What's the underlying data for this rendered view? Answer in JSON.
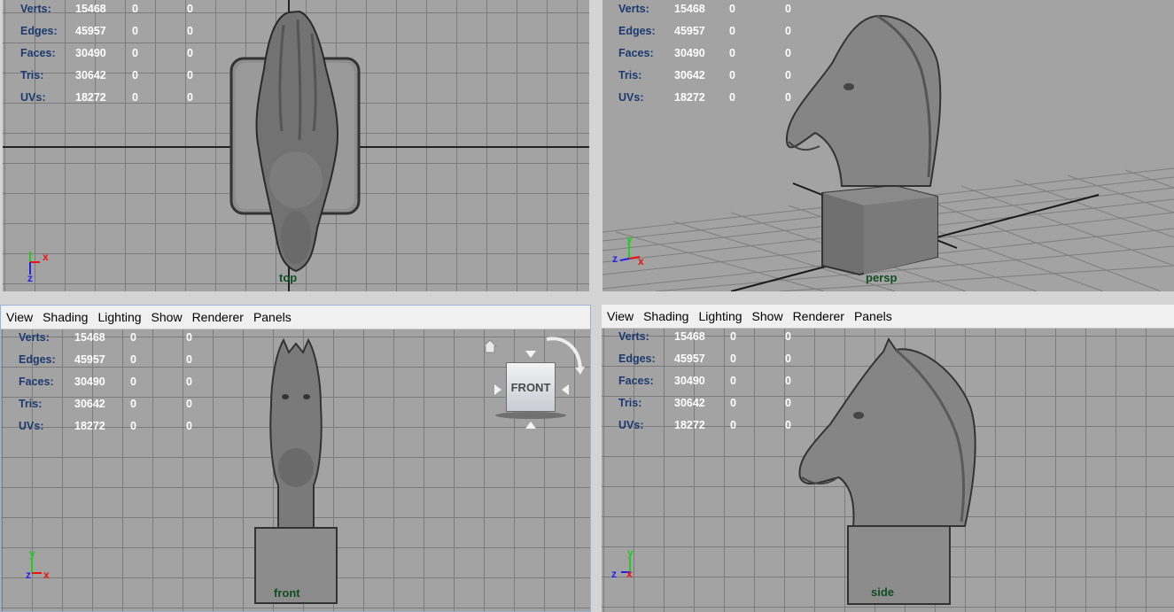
{
  "menu": [
    "View",
    "Shading",
    "Lighting",
    "Show",
    "Renderer",
    "Panels"
  ],
  "hud": {
    "labels": [
      "Verts:",
      "Edges:",
      "Faces:",
      "Tris:",
      "UVs:"
    ],
    "values": [
      "15468",
      "45957",
      "30490",
      "30642",
      "18272"
    ],
    "zeros": [
      "0",
      "0"
    ]
  },
  "viewports": {
    "top": {
      "camera": "top"
    },
    "persp": {
      "camera": "persp"
    },
    "front": {
      "camera": "front"
    },
    "side": {
      "camera": "side"
    }
  },
  "viewcube": {
    "face": "FRONT"
  },
  "axes": {
    "x": "x",
    "y": "y",
    "z": "z"
  },
  "colors": {
    "viewport_bg": "#a3a3a3",
    "grid": "#7b7b7b",
    "hud_label": "#1c3a6f",
    "hud_value": "#ffffff",
    "camera_label": "#0f4d22",
    "axis_x": "#e11",
    "axis_y": "#2c2",
    "axis_z": "#22e"
  }
}
